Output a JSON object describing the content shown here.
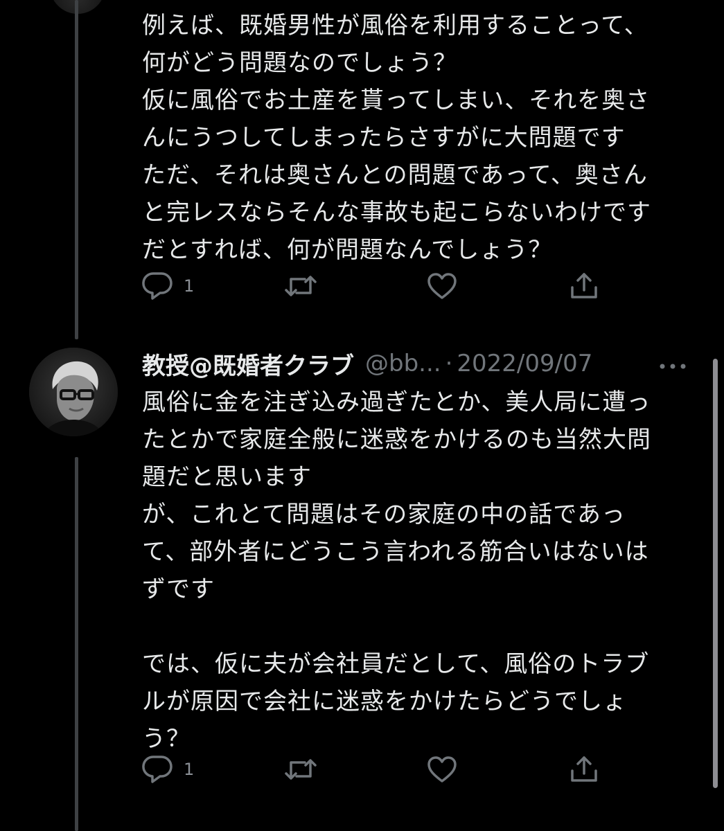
{
  "tweet1": {
    "text": "例えば、既婚男性が風俗を利用することって、\n何がどう問題なのでしょう？\n仮に風俗でお土産を貰ってしまい、それを奥さ\nんにうつしてしまったらさすがに大問題です\nただ、それは奥さんとの問題であって、奥さん\nと完レスならそんな事故も起こらないわけです\nだとすれば、何が問題なんでしょう？",
    "reply_count": "1"
  },
  "tweet2": {
    "author_name": "教授@既婚者クラブ",
    "handle": "@bb...",
    "separator": "·",
    "date": "2022/09/07",
    "text": "風俗に金を注ぎ込み過ぎたとか、美人局に遭っ\nたとかで家庭全般に迷惑をかけるのも当然大問\n題だと思います\nが、これとて問題はその家庭の中の話であっ\nて、部外者にどうこう言われる筋合いはないは\nずです\n\nでは、仮に夫が会社員だとして、風俗のトラブ\nルが原因で会社に迷惑をかけたらどうでしょ\nう？",
    "reply_count": "1"
  },
  "icons": {
    "reply": "reply-icon",
    "retweet": "retweet-icon",
    "like": "heart-icon",
    "share": "share-icon",
    "more": "more-icon"
  },
  "colors": {
    "background": "#000000",
    "text": "#e7e9ea",
    "secondary": "#71767b",
    "thread_line": "#3e4144"
  }
}
